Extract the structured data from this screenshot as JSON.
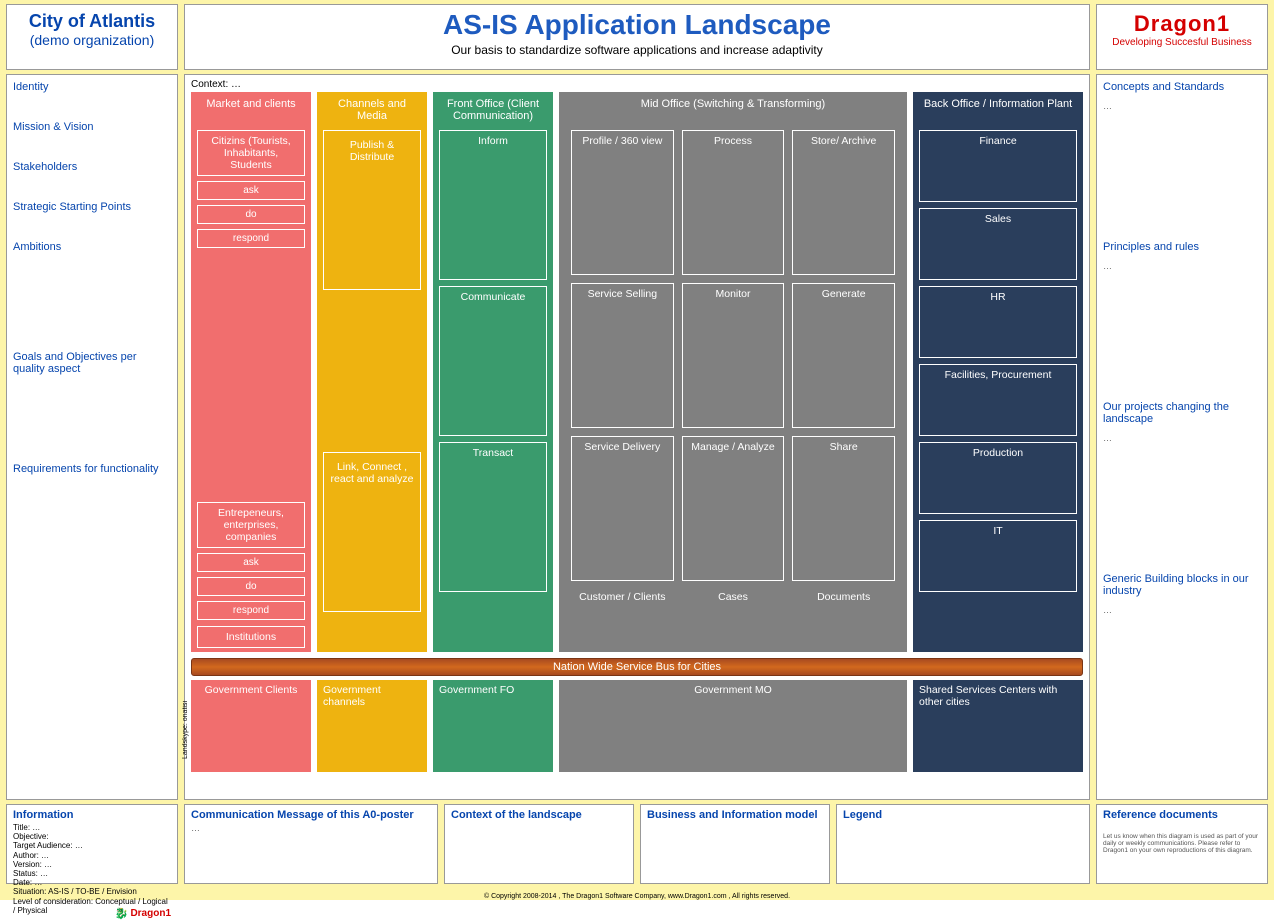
{
  "top": {
    "org_title": "City of Atlantis",
    "org_sub": "(demo organization)",
    "main_title": "AS-IS Application Landscape",
    "subtitle": "Our basis to standardize software applications and increase adaptivity",
    "brand": "Dragon1",
    "brand_sub": "Developing Succesful Business"
  },
  "left_nav": {
    "items": [
      "Identity",
      "Mission & Vision",
      "Stakeholders",
      "Strategic Starting Points",
      "Ambitions",
      "Goals and Objectives per quality aspect",
      "Requirements for functionality"
    ]
  },
  "right_nav": {
    "s1": "Concepts and Standards",
    "s2": "Principles and rules",
    "s3": "Our projects changing the landscape",
    "s4": "Generic Building blocks in our industry"
  },
  "center": {
    "context": "Context: …",
    "vlabel": "Landskype: onatisi",
    "market": {
      "title": "Market and clients",
      "group1_title": "Citizins (Tourists, Inhabitants, Students",
      "group2_title": "Entrepeneurs, enterprises, companies",
      "ask": "ask",
      "do": "do",
      "respond": "respond",
      "institutions": "Institutions"
    },
    "channels": {
      "title": "Channels and Media",
      "b1": "Publish & Distribute",
      "b2": "Link, Connect , react and analyze"
    },
    "front": {
      "title": "Front Office (Client Communication)",
      "b1": "Inform",
      "b2": "Communicate",
      "b3": "Transact"
    },
    "mid": {
      "title": "Mid Office (Switching & Transforming)",
      "cells": [
        "Profile / 360 view",
        "Process",
        "Store/ Archive",
        "Service Selling",
        "Monitor",
        "Generate",
        "Service Delivery",
        "Manage / Analyze",
        "Share"
      ],
      "footers": [
        "Customer / Clients",
        "Cases",
        "Documents"
      ]
    },
    "back": {
      "title": "Back Office / Information Plant",
      "items": [
        "Finance",
        "Sales",
        "HR",
        "Facilities, Procurement",
        "Production",
        "IT"
      ]
    },
    "bus": "Nation Wide Service Bus for Cities",
    "gov": {
      "market": "Government Clients",
      "channels": "Government channels",
      "front": "Government FO",
      "mid": "Government MO",
      "back": "Shared Services Centers with other cities"
    }
  },
  "bottom": {
    "info_title": "Information",
    "info_lines": [
      "Title: …",
      "Objective:",
      "Target Audience: …",
      "",
      "Author: …",
      "Version: …",
      "Status: …",
      "Date: …",
      "Situation: AS-IS / TO-BE / Envision",
      "Level of consideration: Conceptual / Logical / Physical"
    ],
    "logo_text": "Dragon1",
    "comm": "Communication Message of this A0-poster",
    "ctx": "Context of the landscape",
    "biz": "Business and Information model",
    "legend": "Legend",
    "ref": "Reference documents",
    "fineprint": "Let us know when this diagram is used as part of your daily or weekly communications. Please refer to Dragon1 on your own reproductions of this diagram."
  },
  "copyright": "© Copyright 2008-2014 , The Dragon1 Software Company, www.Dragon1.com , All rights reserved."
}
